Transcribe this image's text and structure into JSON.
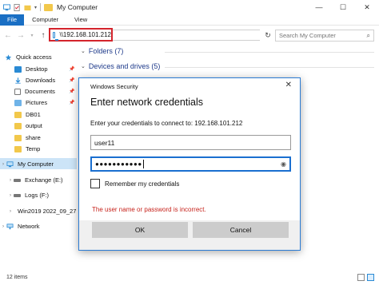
{
  "window": {
    "title": "My Computer",
    "controls": {
      "minimize": "—",
      "maximize": "☐",
      "close": "✕"
    }
  },
  "ribbon": {
    "tabs": [
      {
        "label": "File",
        "active": true
      },
      {
        "label": "Computer"
      },
      {
        "label": "View"
      }
    ]
  },
  "address": {
    "back": "←",
    "forward": "→",
    "up": "↑",
    "path": "\\\\192.168.101.212",
    "refresh": "↻",
    "search_placeholder": "Search My Computer",
    "highlight_color": "#d4242c"
  },
  "sidebar": {
    "quick_access": "Quick access",
    "items": [
      {
        "label": "Desktop",
        "icon": "desktop-icon",
        "pinned": true
      },
      {
        "label": "Downloads",
        "icon": "downloads-icon",
        "pinned": true
      },
      {
        "label": "Documents",
        "icon": "documents-icon",
        "pinned": true
      },
      {
        "label": "Pictures",
        "icon": "pictures-icon",
        "pinned": true
      },
      {
        "label": "DB01",
        "icon": "folder-icon"
      },
      {
        "label": "output",
        "icon": "folder-icon"
      },
      {
        "label": "share",
        "icon": "folder-icon"
      },
      {
        "label": "Temp",
        "icon": "folder-icon"
      }
    ],
    "my_computer": "My Computer",
    "drives": [
      {
        "label": "Exchange (E:)",
        "icon": "drive-icon"
      },
      {
        "label": "Logs (F:)",
        "icon": "drive-icon"
      },
      {
        "label": "Win2019 2022_09_27 (",
        "icon": "drive-icon"
      }
    ],
    "network": "Network"
  },
  "main": {
    "groups": [
      {
        "label": "Folders (7)"
      },
      {
        "label": "Devices and drives (5)"
      }
    ]
  },
  "status": {
    "count": "12 items"
  },
  "dialog": {
    "window_title": "Windows Security",
    "close": "✕",
    "heading": "Enter network credentials",
    "description": "Enter your credentials to connect to: 192.168.101.212",
    "username": "user11",
    "password_mask": "●●●●●●●●●●●",
    "eye": "◉",
    "remember_label": "Remember my credentials",
    "remember_checked": false,
    "error": "The user name or password is incorrect.",
    "error_color": "#c7231c",
    "ok_label": "OK",
    "cancel_label": "Cancel"
  }
}
